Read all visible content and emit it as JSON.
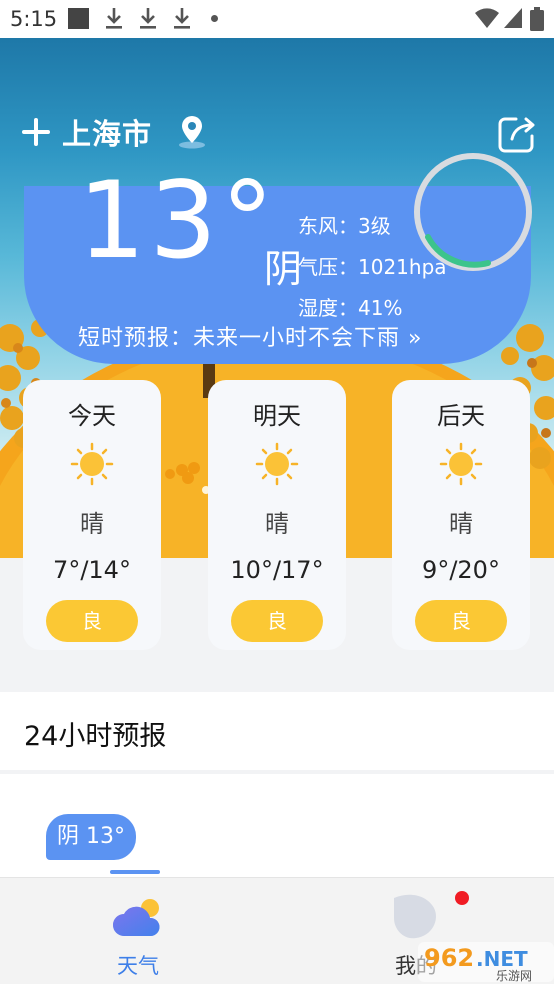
{
  "status_bar": {
    "time": "5:15",
    "icons": [
      "notification-square-icon",
      "download-icon",
      "download-icon",
      "download-icon",
      "dot-icon",
      "wifi-icon",
      "signal-icon",
      "battery-icon"
    ]
  },
  "header": {
    "city": "上海市",
    "add_icon": "plus-icon",
    "location_icon": "location-pin-icon",
    "share_icon": "share-icon"
  },
  "current": {
    "temperature": "13°",
    "condition": "阴",
    "wind": "东风：3级",
    "pressure": "气压：1021hpa",
    "humidity": "湿度：41%",
    "short_forecast": "短时预报：未来一小时不会下雨 »"
  },
  "days": [
    {
      "day": "今天",
      "icon": "sun-icon",
      "condition": "晴",
      "range": "7°/14°",
      "aqi": "良"
    },
    {
      "day": "明天",
      "icon": "sun-icon",
      "condition": "晴",
      "range": "10°/17°",
      "aqi": "良"
    },
    {
      "day": "后天",
      "icon": "sun-icon",
      "condition": "晴",
      "range": "9°/20°",
      "aqi": "良"
    }
  ],
  "hourly": {
    "title": "24小时预报",
    "first_label": "阴 13°"
  },
  "nav": {
    "weather_label": "天气",
    "me_label": "我的"
  },
  "colors": {
    "accent_blue": "#5b93f2",
    "aqi_yellow": "#fbc834",
    "alert_red": "#f01c24"
  },
  "watermark": {
    "text": "962.NET",
    "sub": "乐游网"
  }
}
